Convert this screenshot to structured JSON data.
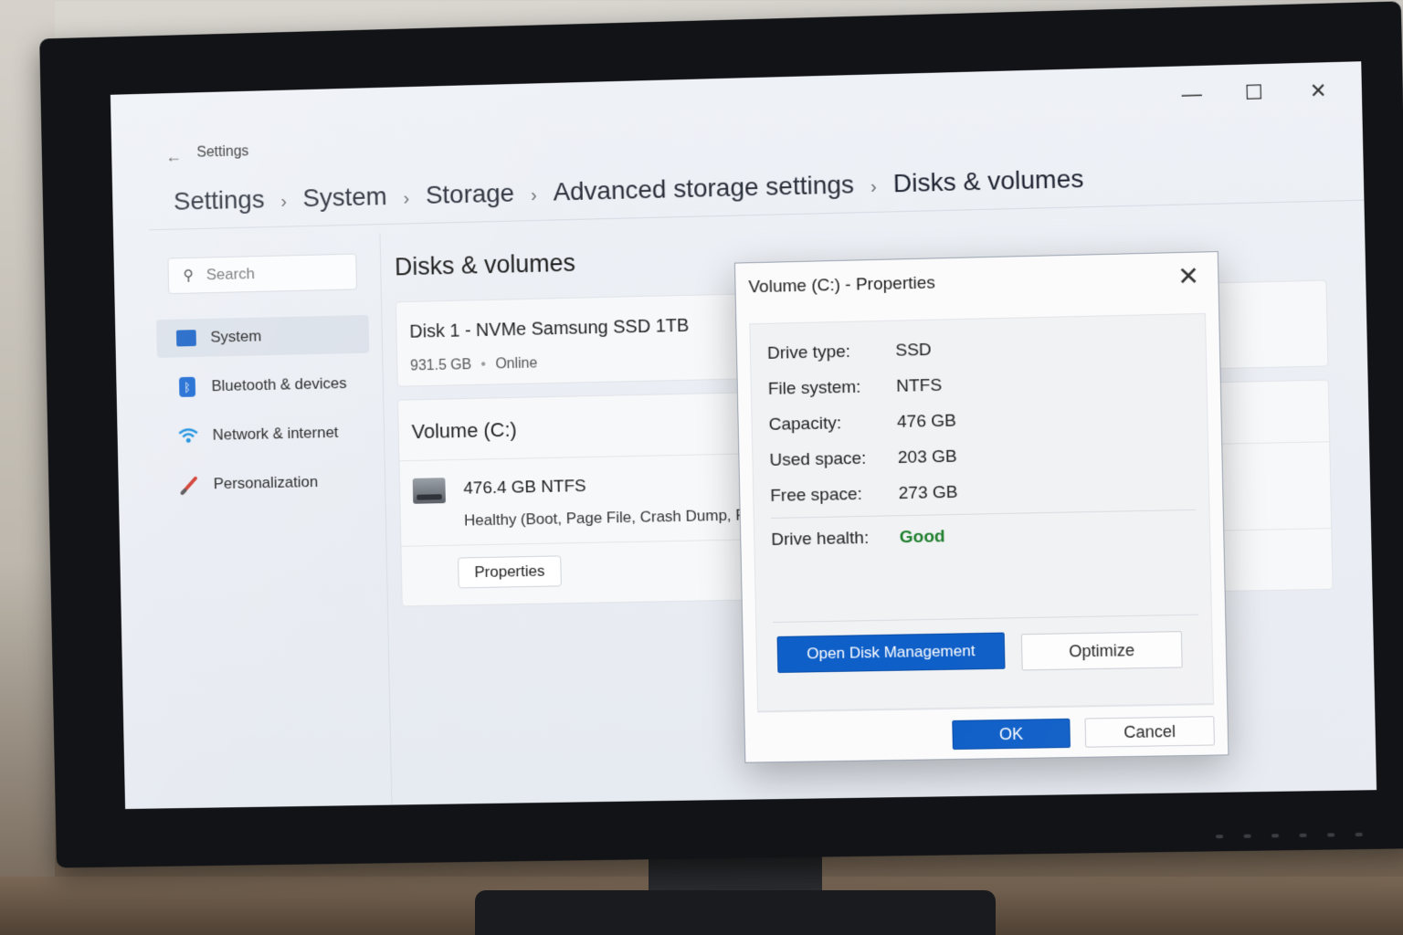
{
  "window": {
    "app_title": "Settings",
    "back_symbol": "←",
    "minimize_symbol": "—",
    "maximize_symbol": "☐",
    "close_symbol": "✕"
  },
  "breadcrumb": {
    "items": [
      "Settings",
      "System",
      "Storage",
      "Advanced storage settings",
      "Disks & volumes"
    ],
    "separator": "›"
  },
  "sidebar": {
    "search_placeholder": "Search",
    "items": [
      {
        "label": "System",
        "icon": "monitor-icon",
        "active": true
      },
      {
        "label": "Bluetooth & devices",
        "icon": "bluetooth-icon"
      },
      {
        "label": "Network & internet",
        "icon": "wifi-icon"
      },
      {
        "label": "Personalization",
        "icon": "brush-icon"
      }
    ]
  },
  "main": {
    "title": "Disks & volumes",
    "disk": {
      "name_bold": "Disk 1",
      "name_rest": " - NVMe Samsung SSD 1TB",
      "size": "931.5 GB",
      "dot": "•",
      "status": "Online"
    },
    "volume": {
      "title": "Volume (C:)",
      "size_fs": "476.4 GB NTFS",
      "health": "Healthy (Boot, Page File, Crash Dump, Pr",
      "properties_button": "Properties"
    }
  },
  "dialog": {
    "title": "Volume (C:) - Properties",
    "close_symbol": "✕",
    "properties": [
      {
        "label": "Drive type:",
        "value": "SSD"
      },
      {
        "label": "File system:",
        "value": "NTFS"
      },
      {
        "label": "Capacity:",
        "value": "476 GB"
      },
      {
        "label": "Used space:",
        "value": "203 GB"
      },
      {
        "label": "Free space:",
        "value": "273 GB"
      }
    ],
    "health_label": "Drive health:",
    "health_value": "Good",
    "open_disk_management": "Open Disk Management",
    "optimize": "Optimize",
    "ok": "OK",
    "cancel": "Cancel"
  },
  "colors": {
    "accent": "#0f5fc8",
    "health_good": "#1e7f2c"
  }
}
